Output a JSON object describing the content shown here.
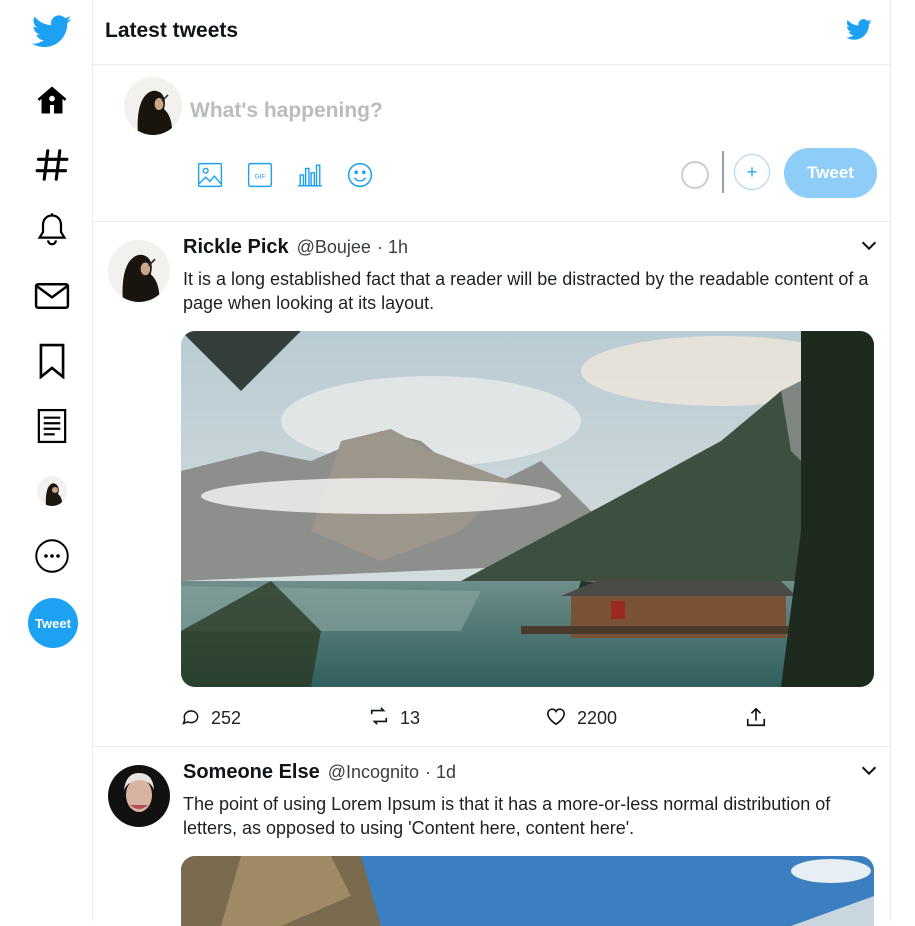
{
  "nav": {
    "items": [
      "twitter-logo",
      "home-icon",
      "explore-hashtag-icon",
      "notifications-bell-icon",
      "messages-envelope-icon",
      "bookmarks-icon",
      "lists-icon",
      "profile-avatar",
      "more-icon"
    ],
    "tweet_button_label": "Tweet"
  },
  "header": {
    "title": "Latest tweets"
  },
  "composer": {
    "placeholder": "What's happening?",
    "tweet_button_label": "Tweet",
    "tools": [
      "image-icon",
      "gif-icon",
      "poll-icon",
      "emoji-icon"
    ]
  },
  "tweets": [
    {
      "name": "Rickle Pick",
      "handle": "@Boujee",
      "time": "· 1h",
      "text": "It is a long established fact that a reader will be distracted by the readable content of a page when looking at its layout.",
      "replies": "252",
      "retweets": "13",
      "likes": "2200"
    },
    {
      "name": "Someone Else",
      "handle": "@Incognito",
      "time": "· 1d",
      "text": "The point of using Lorem Ipsum is that it has a more-or-less normal distribution of letters, as opposed to using 'Content here, content here'."
    }
  ],
  "colors": {
    "accent": "#1da1f2",
    "accent_light": "#8ecdf7",
    "border": "#e6ecf0"
  }
}
